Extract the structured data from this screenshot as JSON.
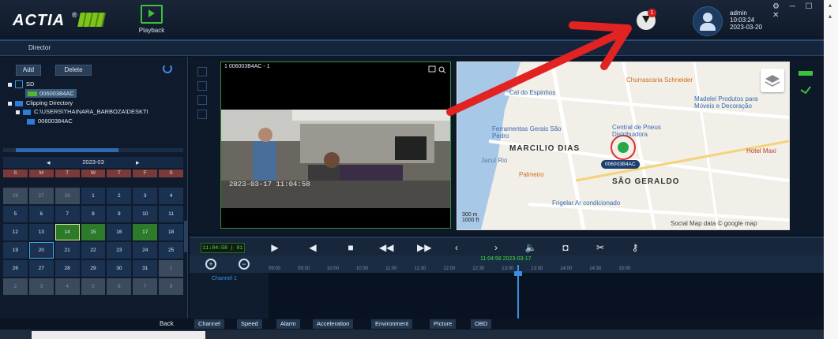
{
  "app": {
    "logo_text": "ACTIA",
    "logo_mark": "®",
    "playback_label": "Playback",
    "notification_count": "1",
    "user": {
      "name": "admin",
      "time": "10:03:24",
      "date": "2023-03-20"
    },
    "window_controls": "⚙ ─ ☐ ✕"
  },
  "subtabs": {
    "director": "Director"
  },
  "left": {
    "add_label": "Add",
    "delete_label": "Delete",
    "tree": {
      "sd_label": "SD",
      "sd_device": "00600384AC",
      "clip_label": "Clipping Directory",
      "clip_path": "C:\\USERS\\THAINARA_BARBOZA\\DESKTI",
      "clip_device": "00600384AC"
    },
    "calendar": {
      "month": "2023-03",
      "prev": "◂",
      "next": "▸",
      "weekdays": [
        "S",
        "M",
        "T",
        "W",
        "T",
        "F",
        "S"
      ],
      "rows": [
        [
          "26",
          "27",
          "28",
          "1",
          "2",
          "3",
          "4"
        ],
        [
          "5",
          "6",
          "7",
          "8",
          "9",
          "10",
          "11"
        ],
        [
          "12",
          "13",
          "14",
          "15",
          "16",
          "17",
          "18"
        ],
        [
          "19",
          "20",
          "21",
          "22",
          "23",
          "24",
          "25"
        ],
        [
          "26",
          "27",
          "28",
          "29",
          "30",
          "31",
          "1"
        ],
        [
          "2",
          "3",
          "4",
          "5",
          "6",
          "7",
          "8"
        ]
      ]
    }
  },
  "video": {
    "title": "1 006003B4AC - 1",
    "timestamp": "2023-03-17 11:04:58"
  },
  "map": {
    "labels": {
      "churrascaria": "Churrascaria Schneider",
      "madelei": "Madelei Produtos para Móveis e Decoração",
      "central": "Central de Pneus Distribuidora",
      "ferramentas": "Ferramentas Gerais São Pedro",
      "marcilio": "MARCILIO DIAS",
      "sao_geraldo": "SÃO GERALDO",
      "frigelar": "Frigelar Ar condicionado",
      "hotel": "Hotel Maxi",
      "palmeiro": "Palmeiro",
      "espinhos": "Cal do Espinhos",
      "river": "Jacuí Rio",
      "scale_300": "300 m",
      "scale_1000": "1000 ft",
      "footer": "Social Map data © google map"
    },
    "device_tag": "006003B4AC"
  },
  "toolbar": {
    "time": "11:04:58 | 01"
  },
  "timeline": {
    "stamp": "11:04:58 2023-03-17",
    "channel": "Channel 1",
    "ticks": [
      "09:00",
      "09:30",
      "10:00",
      "10:30",
      "11:00",
      "11:30",
      "12:00",
      "12:30",
      "13:00",
      "13:30",
      "14:00",
      "14:30",
      "15:00"
    ]
  },
  "bottom_tabs": {
    "back": "Back",
    "items": [
      "Channel",
      "Speed",
      "Alarm",
      "Acceleration",
      "Environment",
      "Picture",
      "OBD"
    ]
  },
  "colors": {
    "accent": "#3c8de0",
    "record": "#2d7a2a",
    "arrow": "#e32222"
  }
}
